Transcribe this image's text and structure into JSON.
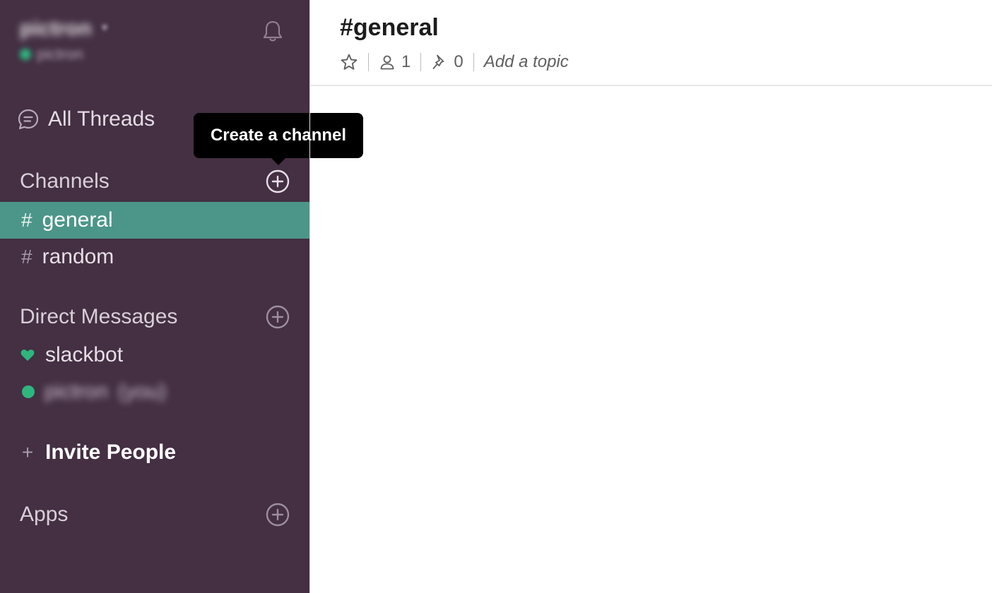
{
  "sidebar": {
    "team_name": "pictron",
    "user_name": "pictron",
    "all_threads_label": "All Threads",
    "channels_heading": "Channels",
    "channels": [
      {
        "name": "general"
      },
      {
        "name": "random"
      }
    ],
    "hash_symbol": "#",
    "dm_heading": "Direct Messages",
    "dms": [
      {
        "name": "slackbot"
      },
      {
        "name": "pictron",
        "suffix": "(you)"
      }
    ],
    "invite_plus": "+",
    "invite_label": "Invite People",
    "apps_heading": "Apps"
  },
  "tooltip": {
    "text": "Create a channel"
  },
  "main": {
    "channel_title": "#general",
    "member_count": "1",
    "pinned_count": "0",
    "topic_placeholder": "Add a topic"
  },
  "colors": {
    "sidebar_bg": "#442f43",
    "active_channel_bg": "#4c9689",
    "presence_green": "#2eb67d",
    "tooltip_bg": "#000000"
  },
  "icons": [
    "bell-icon",
    "threads-icon",
    "add-channel-icon",
    "add-dm-icon",
    "heart-icon",
    "add-app-icon",
    "star-icon",
    "member-icon",
    "pin-icon"
  ]
}
